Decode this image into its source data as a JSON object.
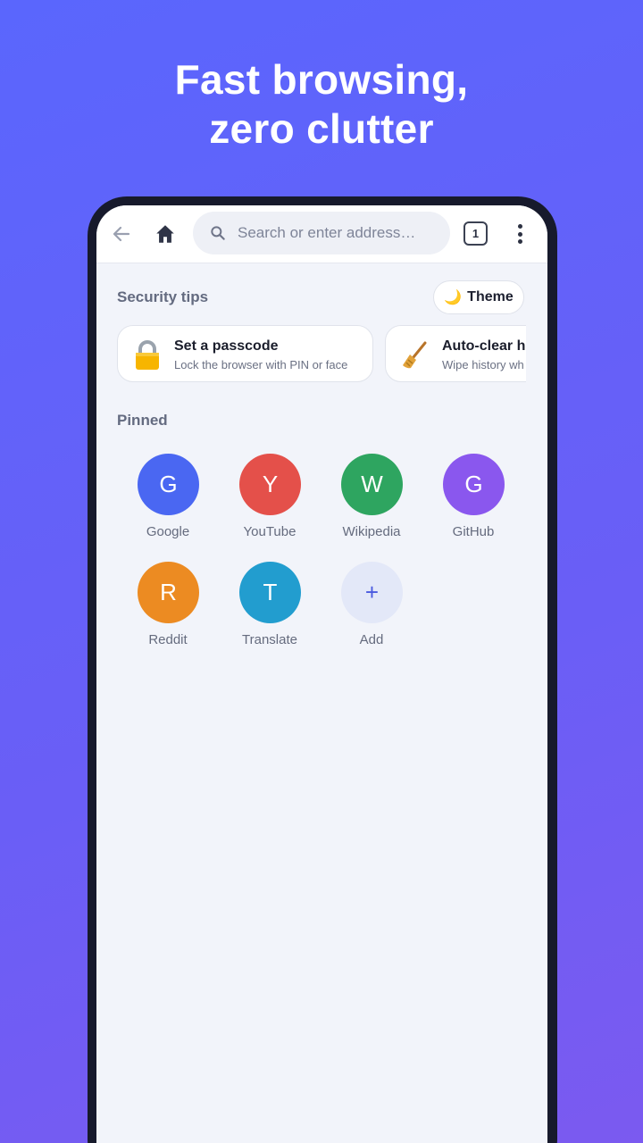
{
  "headline": {
    "line1": "Fast browsing,",
    "line2": "zero clutter"
  },
  "toolbar": {
    "back_icon": "arrow-left-icon",
    "home_icon": "home-icon",
    "search_placeholder": "Search or enter address…",
    "tab_count": "1",
    "menu_icon": "more-vertical-icon"
  },
  "security": {
    "title": "Security tips",
    "theme_label": "Theme",
    "theme_icon": "🌙",
    "tips": [
      {
        "icon": "lock-icon",
        "title": "Set a passcode",
        "subtitle": "Lock the browser with PIN or face"
      },
      {
        "icon": "broom-icon",
        "title": "Auto-clear his",
        "subtitle": "Wipe history wh"
      }
    ]
  },
  "pinned": {
    "title": "Pinned",
    "items": [
      {
        "letter": "G",
        "label": "Google",
        "color": "#4a67f2"
      },
      {
        "letter": "Y",
        "label": "YouTube",
        "color": "#e4504a"
      },
      {
        "letter": "W",
        "label": "Wikipedia",
        "color": "#2ea560"
      },
      {
        "letter": "G",
        "label": "GitHub",
        "color": "#8a57ee"
      },
      {
        "letter": "R",
        "label": "Reddit",
        "color": "#ec8b22"
      },
      {
        "letter": "T",
        "label": "Translate",
        "color": "#229dcf"
      }
    ],
    "add": {
      "symbol": "+",
      "label": "Add"
    }
  }
}
